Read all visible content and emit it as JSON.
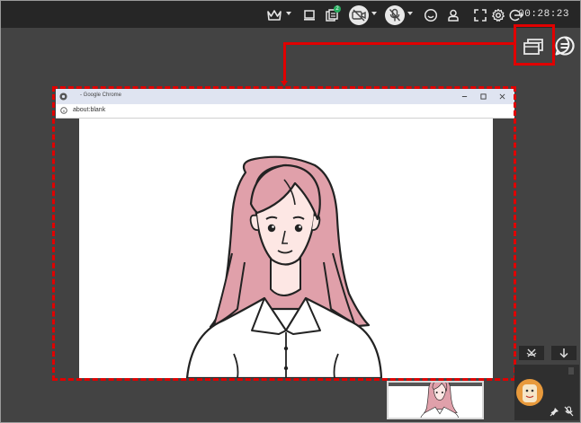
{
  "toolbar": {
    "timer": "00:28:23",
    "share_badge": "2",
    "icons": [
      "crown-icon",
      "laptop-icon",
      "share-screen-icon",
      "camera-off-icon",
      "mic-off-icon",
      "emoji-icon",
      "participants-icon",
      "fullscreen-icon",
      "settings-icon",
      "exit-icon"
    ]
  },
  "side": {
    "icons": [
      "window-switch-icon",
      "chat-icon"
    ]
  },
  "browser": {
    "title": "- Google Chrome",
    "url": "about:blank"
  },
  "bottom": {
    "icons": [
      "mic-off-icon",
      "arrow-down-icon",
      "pin-icon",
      "avatar"
    ]
  },
  "colors": {
    "highlight": "#e00000",
    "toolbar_bg": "#262626",
    "workspace_bg": "#434343"
  }
}
